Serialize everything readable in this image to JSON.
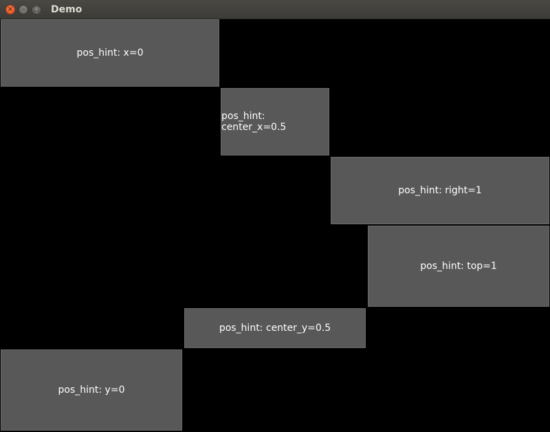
{
  "window": {
    "title": "Demo",
    "controls": {
      "close_glyph": "×",
      "minimize_glyph": "–",
      "maximize_glyph": "□",
      "close_color": "#e95420"
    }
  },
  "buttons": [
    {
      "label": "pos_hint: x=0"
    },
    {
      "label": "pos_hint: center_x=0.5"
    },
    {
      "label": "pos_hint: right=1"
    },
    {
      "label": "pos_hint: top=1"
    },
    {
      "label": "pos_hint: center_y=0.5"
    },
    {
      "label": "pos_hint: y=0"
    }
  ],
  "colors": {
    "background": "#000000",
    "button": "#585858",
    "button_text": "#ffffff",
    "titlebar": "#3c3b37"
  }
}
